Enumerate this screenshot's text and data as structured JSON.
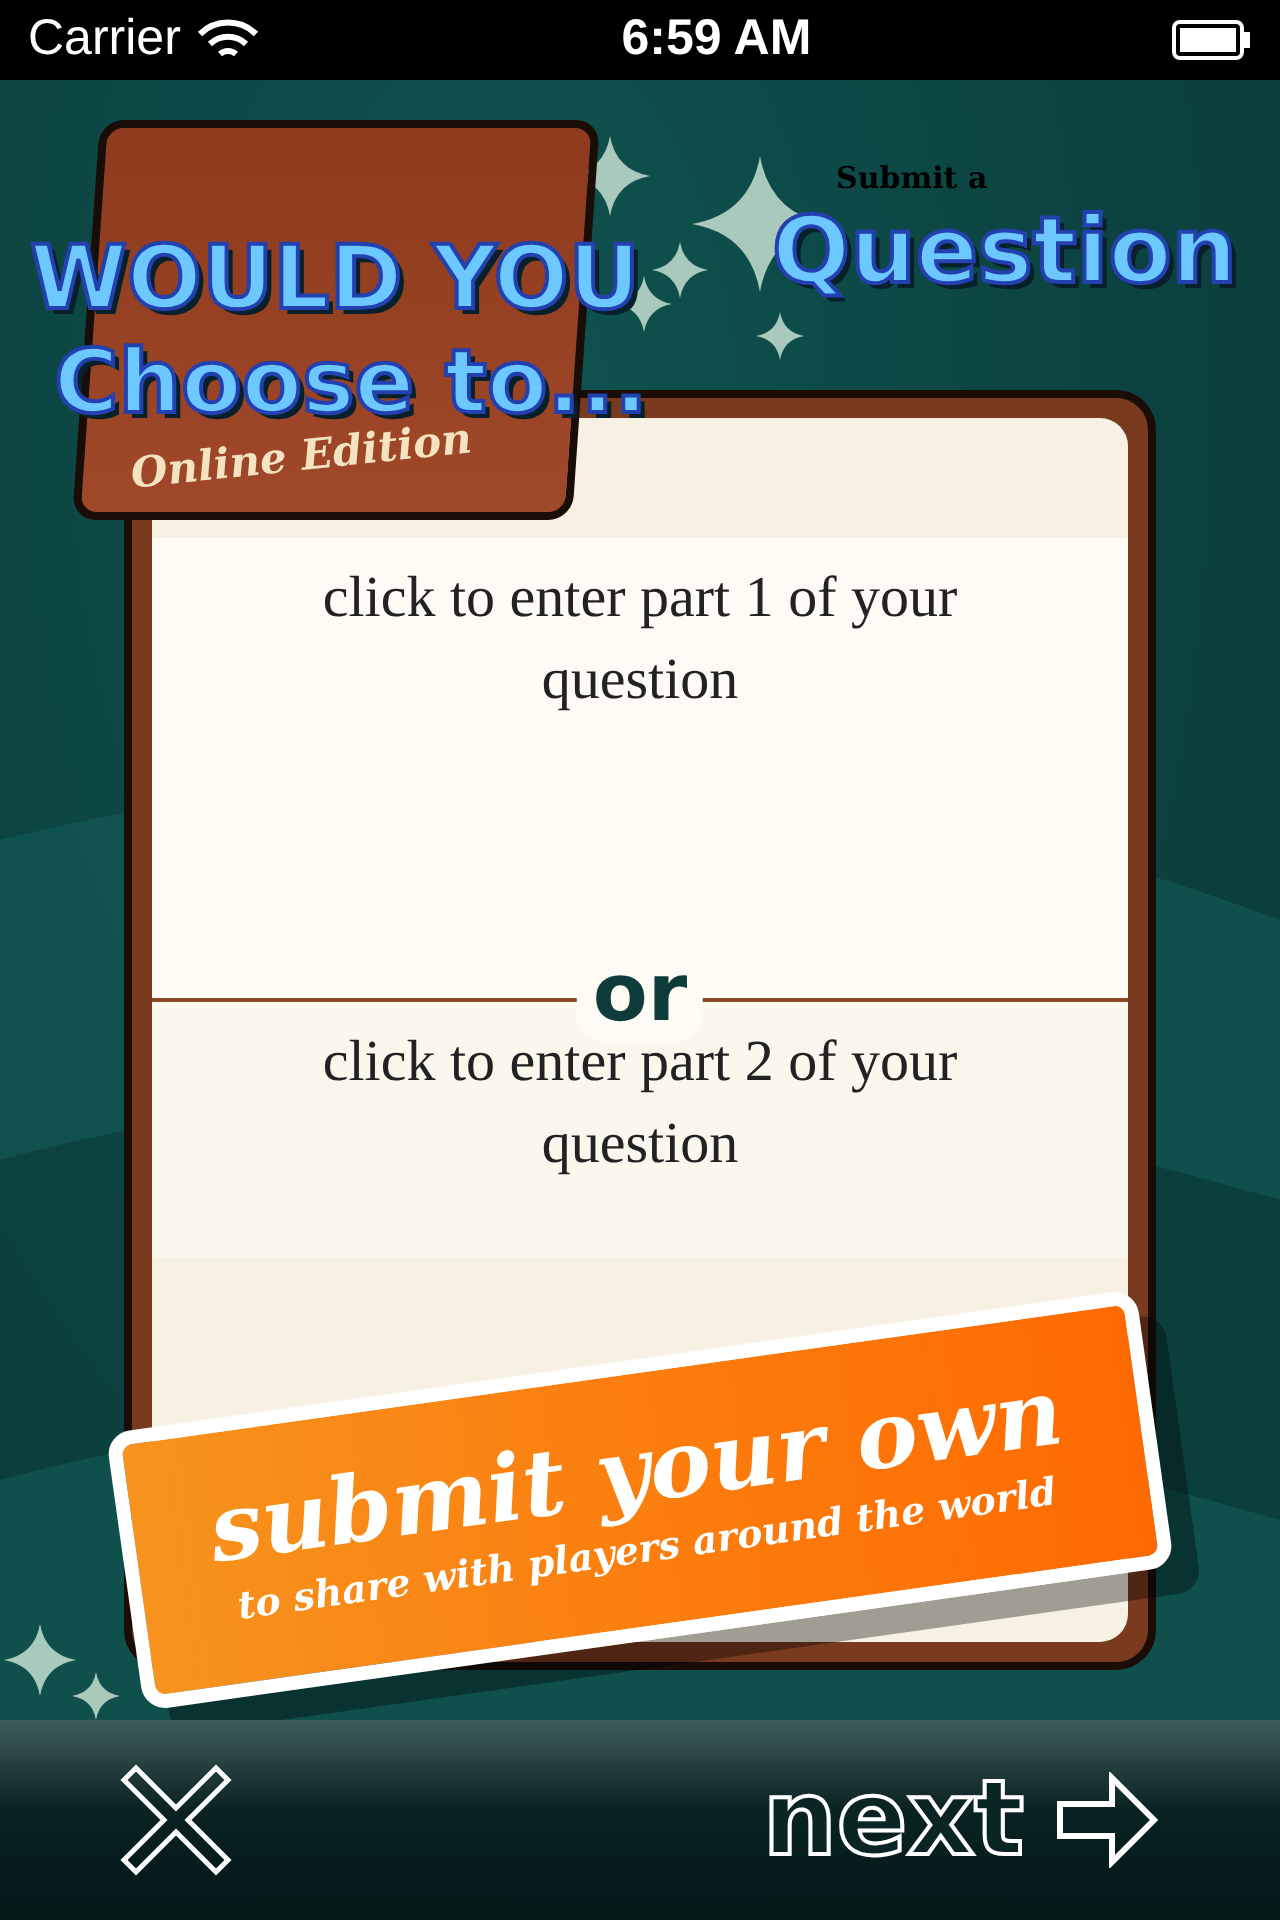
{
  "status_bar": {
    "carrier": "Carrier",
    "time": "6:59 AM"
  },
  "logo": {
    "line_1": "WOULD YOU",
    "line_2": "Choose to...",
    "edition": "Online Edition"
  },
  "header": {
    "kicker": "Submit a",
    "title": "Question"
  },
  "question_parts": [
    {
      "placeholder": "click to enter part 1 of your question"
    },
    {
      "placeholder": "click to enter part 2 of your question"
    }
  ],
  "separator": "or",
  "banner": {
    "title": "submit your own",
    "subtitle": "to share with players around the world"
  },
  "footer": {
    "next": "next"
  }
}
